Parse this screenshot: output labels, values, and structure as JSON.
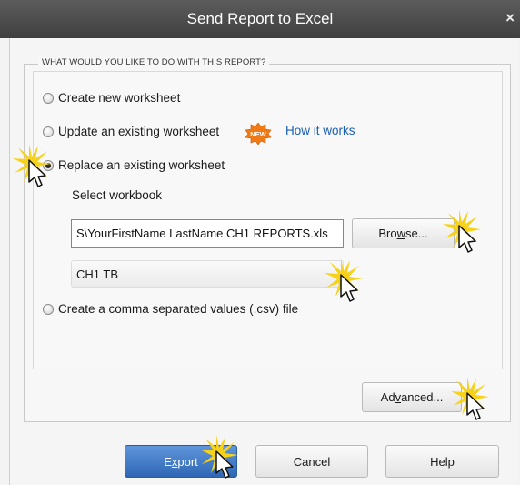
{
  "window": {
    "title": "Send Report to Excel",
    "close_glyph": "×"
  },
  "group": {
    "title": "WHAT WOULD YOU LIKE TO DO WITH THIS REPORT?"
  },
  "options": [
    {
      "label": "Create new worksheet",
      "checked": false
    },
    {
      "label": "Update an existing worksheet",
      "checked": false
    },
    {
      "label": "Replace an existing worksheet",
      "checked": true
    },
    {
      "label": "Create a comma separated values (.csv) file",
      "checked": false
    }
  ],
  "new_badge": {
    "text": "NEW",
    "color": "#f07a16"
  },
  "how_it_works_link": "How it works",
  "select_workbook_label": "Select workbook",
  "workbook_path": "S\\YourFirstName LastName CH1 REPORTS.xls",
  "browse_button": {
    "pre": "Bro",
    "underlined": "w",
    "post": "se..."
  },
  "worksheet_select_value": "CH1 TB",
  "advanced_button": {
    "pre": "Ad",
    "underlined": "v",
    "post": "anced..."
  },
  "footer": {
    "export_button": {
      "pre": "E",
      "underlined": "x",
      "post": "port"
    },
    "cancel_label": "Cancel",
    "help_label": "Help"
  },
  "colors": {
    "title_bar": "#4a4a4a",
    "link": "#1a5fb4",
    "primary_button": "#3e78c6",
    "highlight_burst": "#f7d21a"
  }
}
